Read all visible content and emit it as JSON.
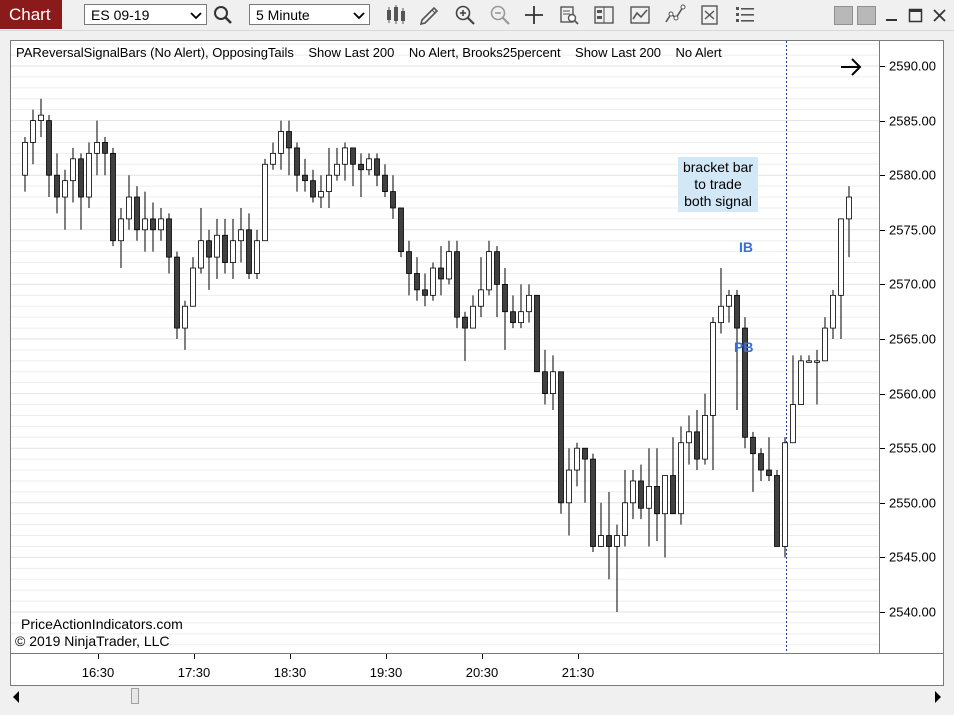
{
  "toolbar": {
    "chart_label": "Chart",
    "instrument": "ES 09-19",
    "interval": "5 Minute",
    "tools": [
      "search-icon",
      "bars-type-icon",
      "draw-pencil-icon",
      "zoom-in-icon",
      "zoom-out-icon",
      "crosshair-icon",
      "data-box-icon",
      "chart-trader-icon",
      "indicators-icon",
      "strategies-icon",
      "templates-icon",
      "properties-icon"
    ]
  },
  "window": {
    "buttons": [
      "tile-left-icon",
      "tile-right-icon",
      "minimize-icon",
      "maximize-icon",
      "close-icon"
    ]
  },
  "indicator_line": "PAReversalSignalBars (No Alert), OpposingTails    Show Last 200    No Alert, Brooks25percent    Show Last 200    No Alert",
  "annotations": {
    "callout": [
      "bracket bar",
      "to trade",
      "both signal"
    ],
    "ib": "IB",
    "pb": "PB"
  },
  "footer": {
    "website": "PriceActionIndicators.com",
    "copyright": "© 2019 NinjaTrader, LLC"
  },
  "colors": {
    "up_body": "#ffffff",
    "down_body": "#404040",
    "accent": "#8b1a1a",
    "signal_label": "#3a6fd8",
    "callout_bg": "#d3e8f7"
  },
  "chart_data": {
    "type": "candlestick",
    "yticks": [
      "2590.00",
      "2585.00",
      "2580.00",
      "2575.00",
      "2570.00",
      "2565.00",
      "2560.00",
      "2555.00",
      "2550.00",
      "2545.00",
      "2540.00"
    ],
    "xticks": [
      "16:30",
      "17:30",
      "18:30",
      "19:30",
      "20:30",
      "21:30"
    ],
    "ylim": [
      2535.5,
      2593.5
    ],
    "candles": [
      [
        2580,
        2583,
        2578.5,
        2583.5
      ],
      [
        2583,
        2585,
        2581,
        2586
      ],
      [
        2585,
        2585.5,
        2583.5,
        2587
      ],
      [
        2585,
        2580,
        2578,
        2585.5
      ],
      [
        2580,
        2578,
        2576.5,
        2582
      ],
      [
        2578,
        2579.5,
        2575,
        2580.5
      ],
      [
        2579.5,
        2581.5,
        2577.5,
        2582.5
      ],
      [
        2581.5,
        2578,
        2575,
        2582
      ],
      [
        2578,
        2582,
        2577,
        2583
      ],
      [
        2582,
        2583,
        2580,
        2585
      ],
      [
        2583,
        2582,
        2580,
        2583.5
      ],
      [
        2582,
        2574,
        2573.5,
        2582.5
      ],
      [
        2574,
        2576,
        2571.5,
        2577
      ],
      [
        2576,
        2578,
        2575,
        2580
      ],
      [
        2578,
        2575,
        2574,
        2579
      ],
      [
        2575,
        2576,
        2573,
        2578.5
      ],
      [
        2576,
        2575,
        2573,
        2577.5
      ],
      [
        2575,
        2576,
        2574,
        2577
      ],
      [
        2576,
        2572.5,
        2571,
        2576.5
      ],
      [
        2572.5,
        2566,
        2565,
        2573
      ],
      [
        2566,
        2568,
        2564,
        2568.5
      ],
      [
        2568,
        2571.5,
        2568,
        2572.5
      ],
      [
        2571.5,
        2574,
        2571,
        2577
      ],
      [
        2574,
        2572.5,
        2569.5,
        2575
      ],
      [
        2572.5,
        2574.5,
        2570.5,
        2576
      ],
      [
        2574.5,
        2572,
        2571,
        2576
      ],
      [
        2572,
        2574,
        2570.5,
        2576
      ],
      [
        2574,
        2575,
        2572,
        2577
      ],
      [
        2575,
        2571,
        2570.5,
        2576.5
      ],
      [
        2571,
        2574,
        2570.5,
        2575
      ],
      [
        2574,
        2581,
        2574,
        2581.5
      ],
      [
        2581,
        2582,
        2580.5,
        2583
      ],
      [
        2582,
        2584,
        2580.5,
        2585
      ],
      [
        2584,
        2582.5,
        2580,
        2585
      ],
      [
        2582.5,
        2580,
        2578.5,
        2583
      ],
      [
        2580,
        2579.5,
        2578.5,
        2581.5
      ],
      [
        2579.5,
        2578,
        2577.5,
        2580.5
      ],
      [
        2578,
        2578.5,
        2577,
        2580
      ],
      [
        2578.5,
        2580,
        2577,
        2582.5
      ],
      [
        2580,
        2581,
        2579.5,
        2582.5
      ],
      [
        2581,
        2582.5,
        2579.5,
        2583
      ],
      [
        2582.5,
        2581,
        2579,
        2582.5
      ],
      [
        2581,
        2580.5,
        2578,
        2582
      ],
      [
        2580.5,
        2581.5,
        2580,
        2582
      ],
      [
        2581.5,
        2580,
        2579,
        2582
      ],
      [
        2580,
        2578.5,
        2578,
        2581
      ],
      [
        2578.5,
        2577,
        2576,
        2580
      ],
      [
        2577,
        2573,
        2572.5,
        2577
      ],
      [
        2573,
        2571,
        2569,
        2574
      ],
      [
        2571,
        2569.5,
        2568.5,
        2572.5
      ],
      [
        2569.5,
        2569,
        2568,
        2571
      ],
      [
        2569,
        2571.5,
        2568.5,
        2572
      ],
      [
        2571.5,
        2570.5,
        2569,
        2573.5
      ],
      [
        2570.5,
        2573,
        2570,
        2574
      ],
      [
        2573,
        2567,
        2566,
        2574
      ],
      [
        2567,
        2566,
        2563,
        2567.5
      ],
      [
        2566,
        2568,
        2566,
        2569
      ],
      [
        2568,
        2569.5,
        2567,
        2572.5
      ],
      [
        2569.5,
        2573,
        2569,
        2574
      ],
      [
        2573,
        2570,
        2567,
        2573.5
      ],
      [
        2570,
        2567.5,
        2564,
        2571.5
      ],
      [
        2567.5,
        2566.5,
        2566,
        2569
      ],
      [
        2566.5,
        2567.5,
        2566,
        2570
      ],
      [
        2567.5,
        2569,
        2566.5,
        2570
      ],
      [
        2569,
        2562,
        2562,
        2569
      ],
      [
        2562,
        2560,
        2559,
        2564
      ],
      [
        2560,
        2562,
        2558.5,
        2563.5
      ],
      [
        2562,
        2550,
        2549,
        2562
      ],
      [
        2550,
        2553,
        2547,
        2555
      ],
      [
        2553,
        2555,
        2551.5,
        2555.5
      ],
      [
        2555,
        2554,
        2550,
        2554.5
      ],
      [
        2554,
        2546,
        2545.5,
        2554.5
      ],
      [
        2546,
        2547,
        2546,
        2550
      ],
      [
        2547,
        2546,
        2543,
        2551
      ],
      [
        2546,
        2547,
        2540,
        2548
      ],
      [
        2547,
        2550,
        2546,
        2553
      ],
      [
        2550,
        2552,
        2548.5,
        2553
      ],
      [
        2552,
        2549.5,
        2548.5,
        2553.5
      ],
      [
        2549.5,
        2551.5,
        2546,
        2555
      ],
      [
        2551.5,
        2549,
        2546.5,
        2555
      ],
      [
        2549,
        2552.5,
        2545,
        2552.5
      ],
      [
        2552.5,
        2549,
        2549,
        2556
      ],
      [
        2549,
        2555.5,
        2548,
        2557
      ],
      [
        2555.5,
        2556.5,
        2553.5,
        2558
      ],
      [
        2556.5,
        2554,
        2553,
        2558.5
      ],
      [
        2554,
        2558,
        2553.5,
        2560
      ],
      [
        2558,
        2566.5,
        2553,
        2567
      ],
      [
        2566.5,
        2568,
        2565.5,
        2571.5
      ],
      [
        2568,
        2569,
        2566.5,
        2569.5
      ],
      [
        2569,
        2566,
        2558.5,
        2569.5
      ],
      [
        2566,
        2556,
        2555,
        2567
      ],
      [
        2556,
        2554.5,
        2551,
        2556.5
      ],
      [
        2554.5,
        2553,
        2552,
        2555
      ],
      [
        2553,
        2552.5,
        2552,
        2556
      ],
      [
        2552.5,
        2546,
        2546,
        2553
      ],
      [
        2546,
        2555.5,
        2545,
        2556
      ],
      [
        2555.5,
        2559,
        2555.5,
        2563.5
      ],
      [
        2559,
        2563,
        2560.5,
        2563.5
      ],
      [
        2563,
        2563,
        2563,
        2563.5
      ],
      [
        2563,
        2563,
        2559,
        2564
      ],
      [
        2563,
        2566,
        2563,
        2567
      ],
      [
        2566,
        2569,
        2565,
        2569.5
      ],
      [
        2569,
        2576,
        2565,
        2576
      ],
      [
        2576,
        2578,
        2572.5,
        2579
      ]
    ]
  }
}
